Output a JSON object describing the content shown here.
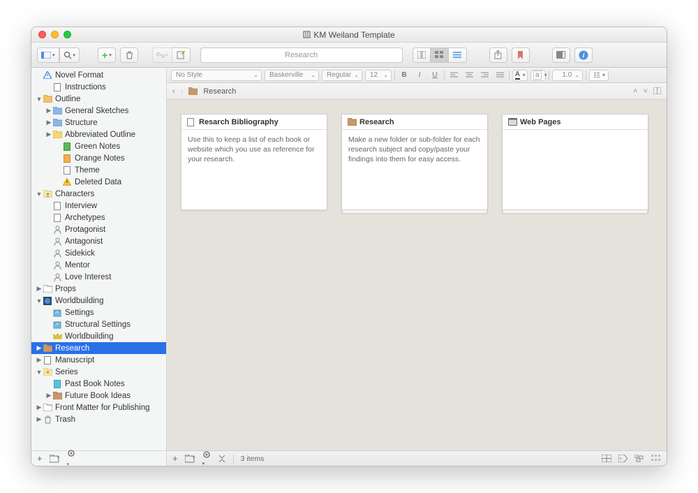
{
  "window": {
    "title": "KM Weiland Template"
  },
  "toolbar": {
    "search_placeholder": "Research"
  },
  "format_bar": {
    "style": "No Style",
    "font": "Baskerville",
    "weight": "Regular",
    "size": "12",
    "line_spacing": "1.0"
  },
  "path": {
    "current": "Research"
  },
  "sidebar": {
    "items": [
      {
        "label": "Novel Format",
        "depth": 0,
        "icon": "triangle-blue",
        "chev": ""
      },
      {
        "label": "Instructions",
        "depth": 1,
        "icon": "doc",
        "chev": ""
      },
      {
        "label": "Outline",
        "depth": 0,
        "icon": "folder-orange",
        "chev": "down"
      },
      {
        "label": "General Sketches",
        "depth": 1,
        "icon": "folder-blue",
        "chev": "right"
      },
      {
        "label": "Structure",
        "depth": 1,
        "icon": "folder-blue",
        "chev": "right"
      },
      {
        "label": "Abbreviated Outline",
        "depth": 1,
        "icon": "folder-yellow",
        "chev": "right"
      },
      {
        "label": "Green Notes",
        "depth": 2,
        "icon": "doc-green",
        "chev": ""
      },
      {
        "label": "Orange Notes",
        "depth": 2,
        "icon": "doc-orange",
        "chev": ""
      },
      {
        "label": "Theme",
        "depth": 2,
        "icon": "doc",
        "chev": ""
      },
      {
        "label": "Deleted Data",
        "depth": 2,
        "icon": "warn",
        "chev": ""
      },
      {
        "label": "Characters",
        "depth": 0,
        "icon": "folder-char",
        "chev": "down"
      },
      {
        "label": "Interview",
        "depth": 1,
        "icon": "doc",
        "chev": ""
      },
      {
        "label": "Archetypes",
        "depth": 1,
        "icon": "doc",
        "chev": ""
      },
      {
        "label": "Protagonist",
        "depth": 1,
        "icon": "person",
        "chev": ""
      },
      {
        "label": "Antagonist",
        "depth": 1,
        "icon": "person",
        "chev": ""
      },
      {
        "label": "Sidekick",
        "depth": 1,
        "icon": "person",
        "chev": ""
      },
      {
        "label": "Mentor",
        "depth": 1,
        "icon": "person",
        "chev": ""
      },
      {
        "label": "Love Interest",
        "depth": 1,
        "icon": "person",
        "chev": ""
      },
      {
        "label": "Props",
        "depth": 0,
        "icon": "folder",
        "chev": "right"
      },
      {
        "label": "Worldbuilding",
        "depth": 0,
        "icon": "globe",
        "chev": "down"
      },
      {
        "label": "Settings",
        "depth": 1,
        "icon": "place-blue",
        "chev": ""
      },
      {
        "label": "Structural Settings",
        "depth": 1,
        "icon": "place-blue",
        "chev": ""
      },
      {
        "label": "Worldbuilding",
        "depth": 1,
        "icon": "crown",
        "chev": ""
      },
      {
        "label": "Research",
        "depth": 0,
        "icon": "folder-brown",
        "chev": "right",
        "selected": true
      },
      {
        "label": "Manuscript",
        "depth": 0,
        "icon": "doc",
        "chev": "right"
      },
      {
        "label": "Series",
        "depth": 0,
        "icon": "folder-star",
        "chev": "down"
      },
      {
        "label": "Past Book Notes",
        "depth": 1,
        "icon": "doc-blue",
        "chev": ""
      },
      {
        "label": "Future Book Ideas",
        "depth": 1,
        "icon": "folder-brown",
        "chev": "right"
      },
      {
        "label": "Front Matter for Publishing",
        "depth": 0,
        "icon": "folder",
        "chev": "right"
      },
      {
        "label": "Trash",
        "depth": 0,
        "icon": "trash",
        "chev": "right"
      }
    ]
  },
  "cards": [
    {
      "title": "Resarch Bibliography",
      "body": "Use this to keep a list of each book or website which you use as reference for your research.",
      "icon": "doc",
      "folder": false
    },
    {
      "title": "Research",
      "body": "Make a new folder or sub-folder for each research subject and copy/paste your findings into them for easy access.",
      "icon": "folder-brown",
      "folder": true
    },
    {
      "title": "Web Pages",
      "body": "",
      "icon": "web",
      "folder": true
    }
  ],
  "footer": {
    "item_count": "3 items"
  }
}
